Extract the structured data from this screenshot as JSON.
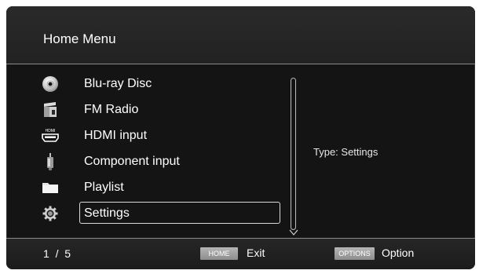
{
  "header": {
    "title": "Home Menu"
  },
  "menu": {
    "items": [
      {
        "label": "Blu-ray Disc",
        "icon": "disc-icon"
      },
      {
        "label": "FM Radio",
        "icon": "radio-icon"
      },
      {
        "label": "HDMI input",
        "icon": "hdmi-icon",
        "icon_text": "HDMI"
      },
      {
        "label": "Component input",
        "icon": "component-plug-icon"
      },
      {
        "label": "Playlist",
        "icon": "folder-icon"
      },
      {
        "label": "Settings",
        "icon": "gear-icon",
        "selected": true
      }
    ]
  },
  "info": {
    "type_text": "Type: Settings"
  },
  "footer": {
    "page_indicator": "1  /  5",
    "home_key": "HOME",
    "home_action": "Exit",
    "options_key": "OPTIONS",
    "options_action": "Option"
  },
  "colors": {
    "background": "#141414",
    "text": "#ffffff",
    "divider": "#8a8a8a"
  }
}
